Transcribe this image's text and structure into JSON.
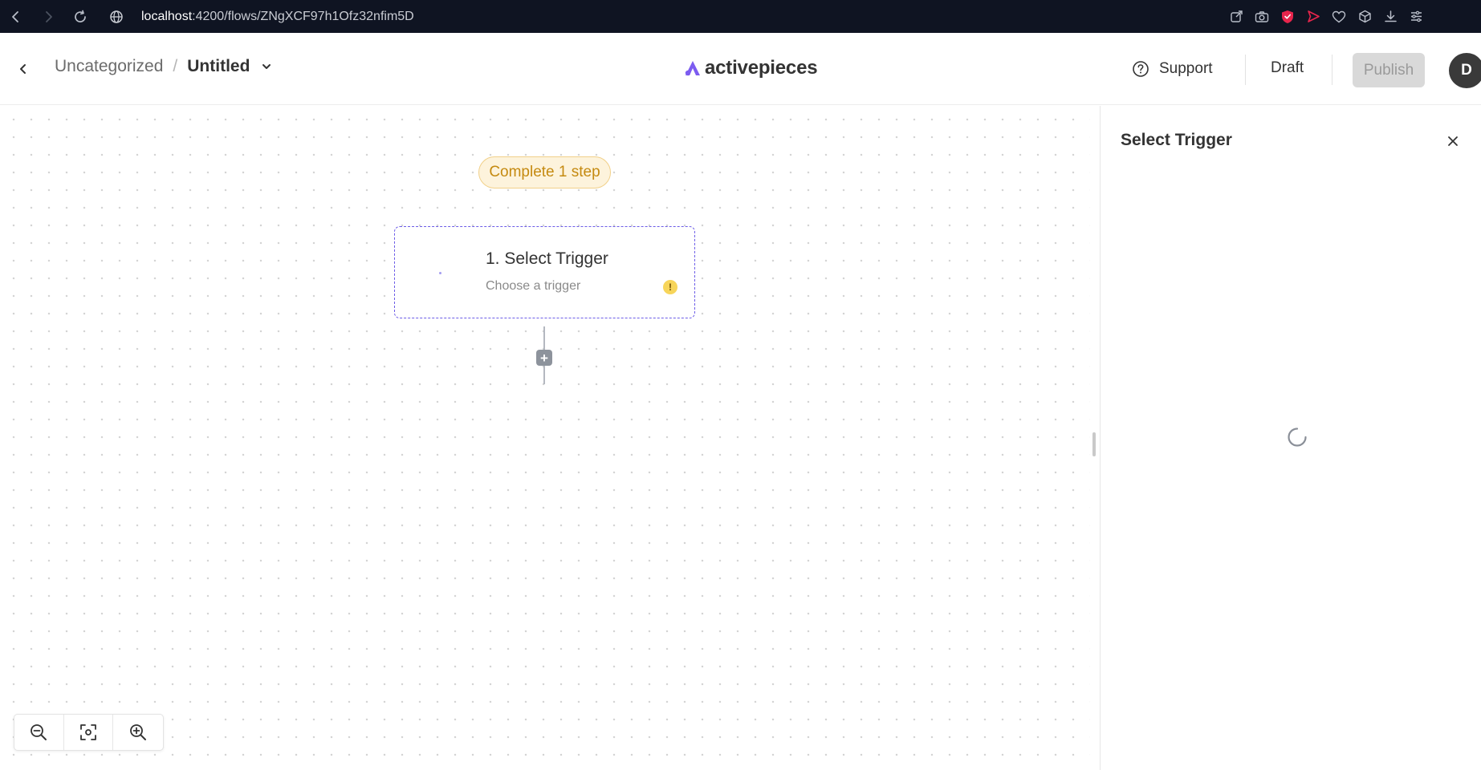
{
  "browser": {
    "url_host": "localhost",
    "url_path": ":4200/flows/ZNgXCF97h1Ofz32nfim5D"
  },
  "header": {
    "breadcrumb_folder": "Uncategorized",
    "breadcrumb_separator": "/",
    "flow_name": "Untitled",
    "logo_text": "activepieces",
    "support_label": "Support",
    "status_label": "Draft",
    "publish_label": "Publish",
    "avatar_initial": "D",
    "accent_color": "#6c5ce7"
  },
  "canvas": {
    "badge_text": "Complete 1 step",
    "trigger_card": {
      "title": "1. Select Trigger",
      "subtitle": "Choose a trigger",
      "warning_symbol": "!"
    },
    "add_button_symbol": "+",
    "zoom_controls": [
      "zoom-out-icon",
      "fit-view-icon",
      "zoom-in-icon"
    ]
  },
  "side_panel": {
    "title": "Select Trigger",
    "loading": true
  }
}
